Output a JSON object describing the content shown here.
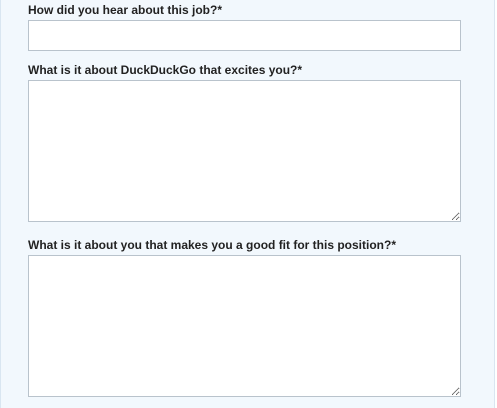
{
  "form": {
    "hear_about": {
      "label": "How did you hear about this job?*",
      "value": ""
    },
    "excites": {
      "label": "What is it about DuckDuckGo that excites you?*",
      "value": ""
    },
    "good_fit": {
      "label": "What is it about you that makes you a good fit for this position?*",
      "value": ""
    }
  }
}
